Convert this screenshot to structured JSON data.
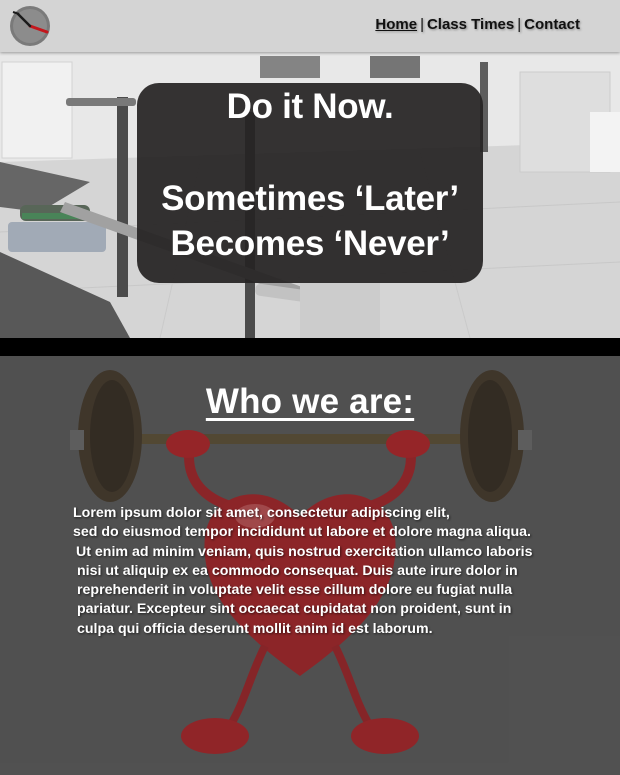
{
  "header": {
    "logo_icon": "stopwatch-icon",
    "nav": {
      "home": "Home",
      "separator": "|",
      "class_times": "Class Times",
      "contact": "Contact"
    }
  },
  "hero": {
    "background": "gym-interior-photo",
    "line1": "Do it Now.",
    "line2": "Sometimes ‘Later’",
    "line3": "Becomes ‘Never’"
  },
  "about": {
    "background": "heart-lifting-barbell-image",
    "title": "Who we are:",
    "lines": [
      "Lorem ipsum dolor sit amet, consectetur adipiscing elit,",
      "sed do eiusmod tempor incididunt ut labore et dolore magna aliqua.",
      "Ut enim ad minim veniam, quis nostrud exercitation ullamco laboris",
      "nisi ut aliquip ex ea commodo consequat. Duis aute irure dolor in",
      "reprehenderit in voluptate velit esse cillum dolore eu fugiat nulla",
      "pariatur. Excepteur sint occaecat cupidatat non proident, sunt in",
      "culpa qui officia deserunt mollit anim id est laborum."
    ]
  },
  "colors": {
    "header_bg": "#d4d4d4",
    "hero_box": "#262424",
    "band": "#000000",
    "about_bg": "#555555",
    "heart_red": "#c0141a"
  }
}
